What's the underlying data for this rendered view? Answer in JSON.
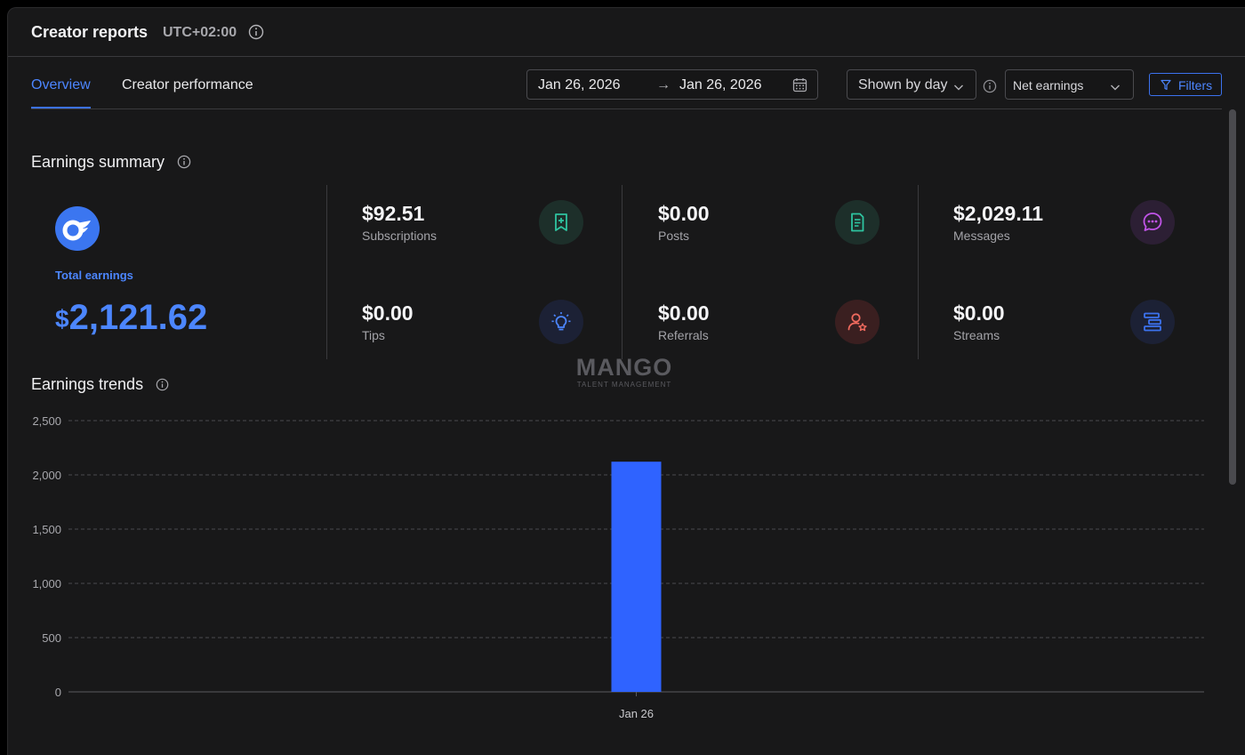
{
  "header": {
    "title": "Creator reports",
    "timezone": "UTC+02:00"
  },
  "tabs": [
    {
      "label": "Overview",
      "active": true
    },
    {
      "label": "Creator performance",
      "active": false
    }
  ],
  "toolbar": {
    "date_from": "Jan 26, 2026",
    "date_to": "Jan 26, 2026",
    "arrow": "→",
    "grouping": "Shown by day",
    "metric": "Net earnings",
    "filters_label": "Filters"
  },
  "summary": {
    "title": "Earnings summary",
    "total_label": "Total earnings",
    "total_currency": "$",
    "total_value": "2,121.62",
    "metrics": [
      {
        "value": "$92.51",
        "label": "Subscriptions",
        "icon": "bookmark-plus-icon",
        "color": "#2ec4a0"
      },
      {
        "value": "$0.00",
        "label": "Posts",
        "icon": "document-icon",
        "color": "#2ec4a0"
      },
      {
        "value": "$2,029.11",
        "label": "Messages",
        "icon": "chat-bubble-icon",
        "color": "#c154e8"
      },
      {
        "value": "$0.00",
        "label": "Tips",
        "icon": "lightbulb-icon",
        "color": "#4c86ff"
      },
      {
        "value": "$0.00",
        "label": "Referrals",
        "icon": "user-star-icon",
        "color": "#f06a5e"
      },
      {
        "value": "$0.00",
        "label": "Streams",
        "icon": "streams-icon",
        "color": "#4c86ff"
      }
    ]
  },
  "watermark": {
    "name": "MANGO",
    "sub": "TALENT MANAGEMENT"
  },
  "trends": {
    "title": "Earnings trends"
  },
  "colors": {
    "accent": "#3c72ee",
    "bar": "#2f63ff"
  },
  "chart_data": {
    "type": "bar",
    "categories": [
      "Jan 26"
    ],
    "values": [
      2121.62
    ],
    "ylim": [
      0,
      2500
    ],
    "yticks": [
      0,
      500,
      1000,
      1500,
      2000,
      2500
    ],
    "ytick_labels": [
      "0",
      "500",
      "1,000",
      "1,500",
      "2,000",
      "2,500"
    ],
    "grid": true,
    "title": "",
    "xlabel": "",
    "ylabel": ""
  }
}
